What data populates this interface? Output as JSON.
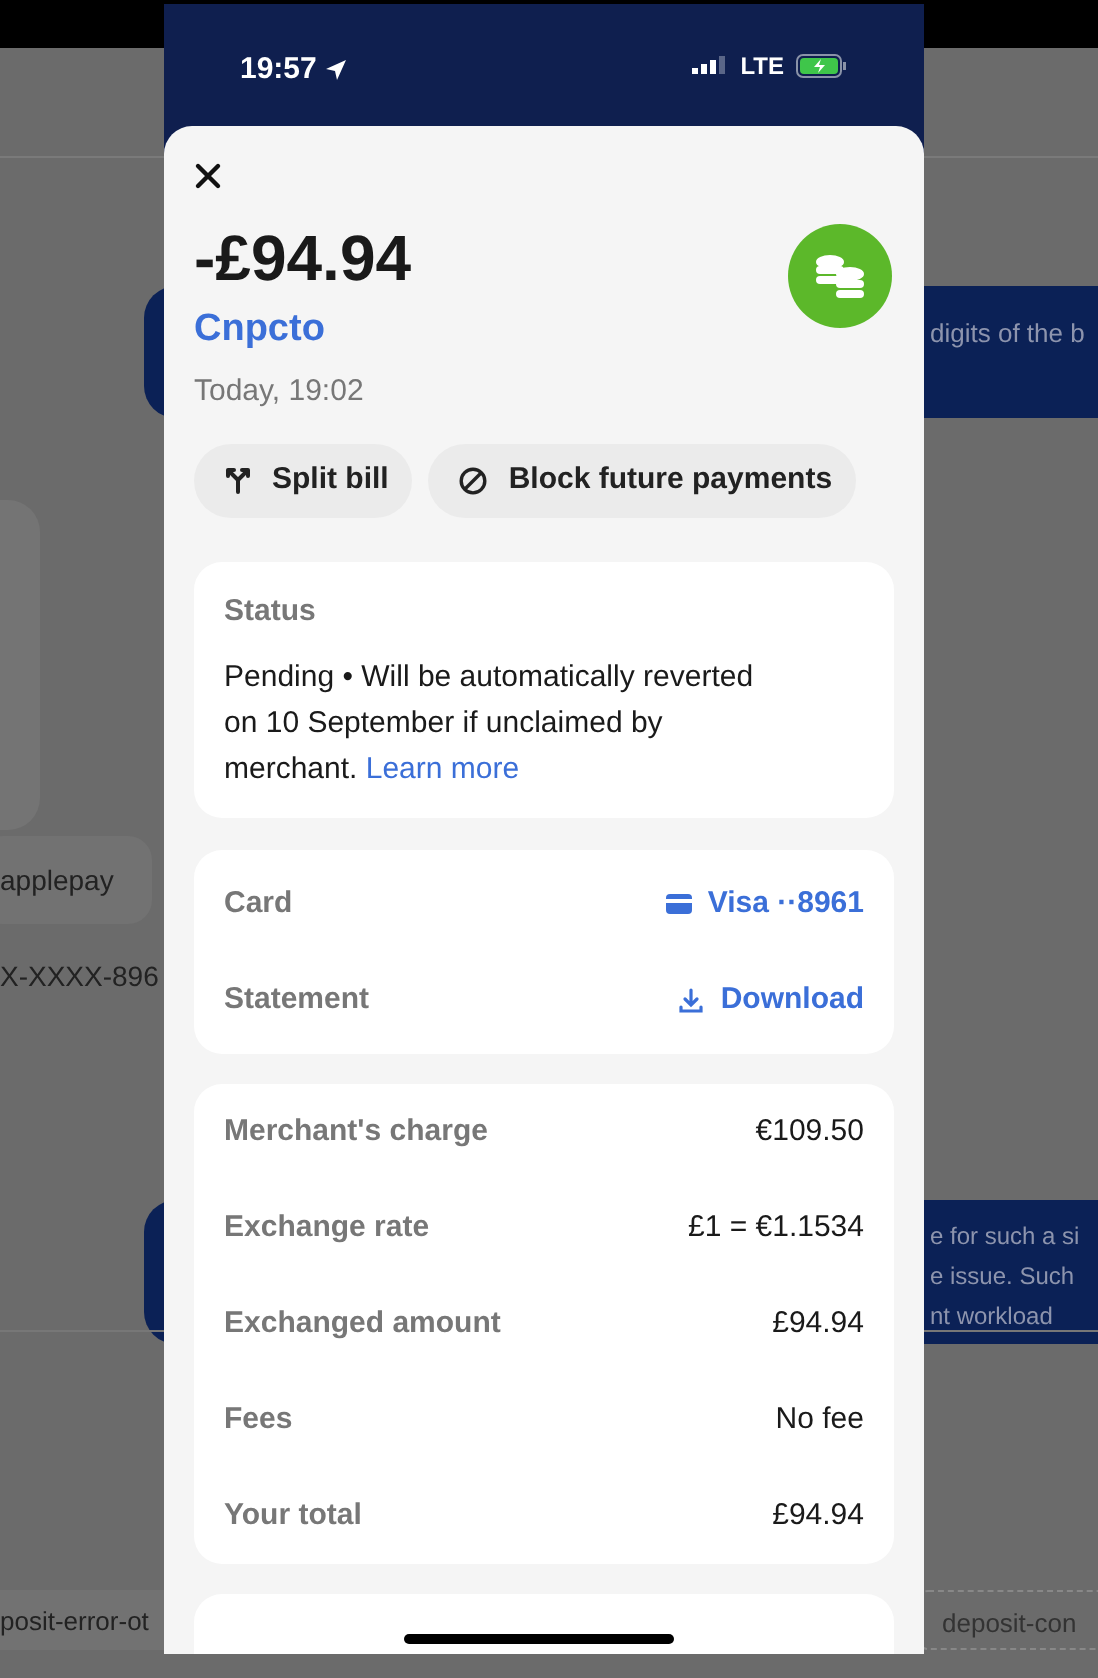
{
  "background": {
    "message_top": "digits of the b",
    "tag": "applepay",
    "card_number": "X-XXXX-896",
    "message_lines": [
      "e for such a si",
      "e issue. Such",
      "nt workload"
    ],
    "chips": [
      "posit-error-ot",
      "deposit-con"
    ]
  },
  "status_bar": {
    "time": "19:57",
    "network": "LTE"
  },
  "transaction": {
    "amount": "-£94.94",
    "merchant": "Cnpcto",
    "date": "Today, 19:02"
  },
  "actions": [
    {
      "label": "Split bill",
      "kind": "split"
    },
    {
      "label": "Block future payments",
      "kind": "block"
    }
  ],
  "status": {
    "title": "Status",
    "text": "Pending • Will be automatically reverted on 10 September if unclaimed by merchant.",
    "link": "Learn more"
  },
  "card_details": [
    {
      "label": "Card",
      "value": "Visa ··8961",
      "kind": "card"
    },
    {
      "label": "Statement",
      "value": "Download",
      "kind": "download"
    }
  ],
  "charges": [
    {
      "label": "Merchant's charge",
      "value": "€109.50"
    },
    {
      "label": "Exchange rate",
      "value": "£1 = €1.1534"
    },
    {
      "label": "Exchanged amount",
      "value": "£94.94"
    },
    {
      "label": "Fees",
      "value": "No fee"
    },
    {
      "label": "Your total",
      "value": "£94.94"
    }
  ]
}
